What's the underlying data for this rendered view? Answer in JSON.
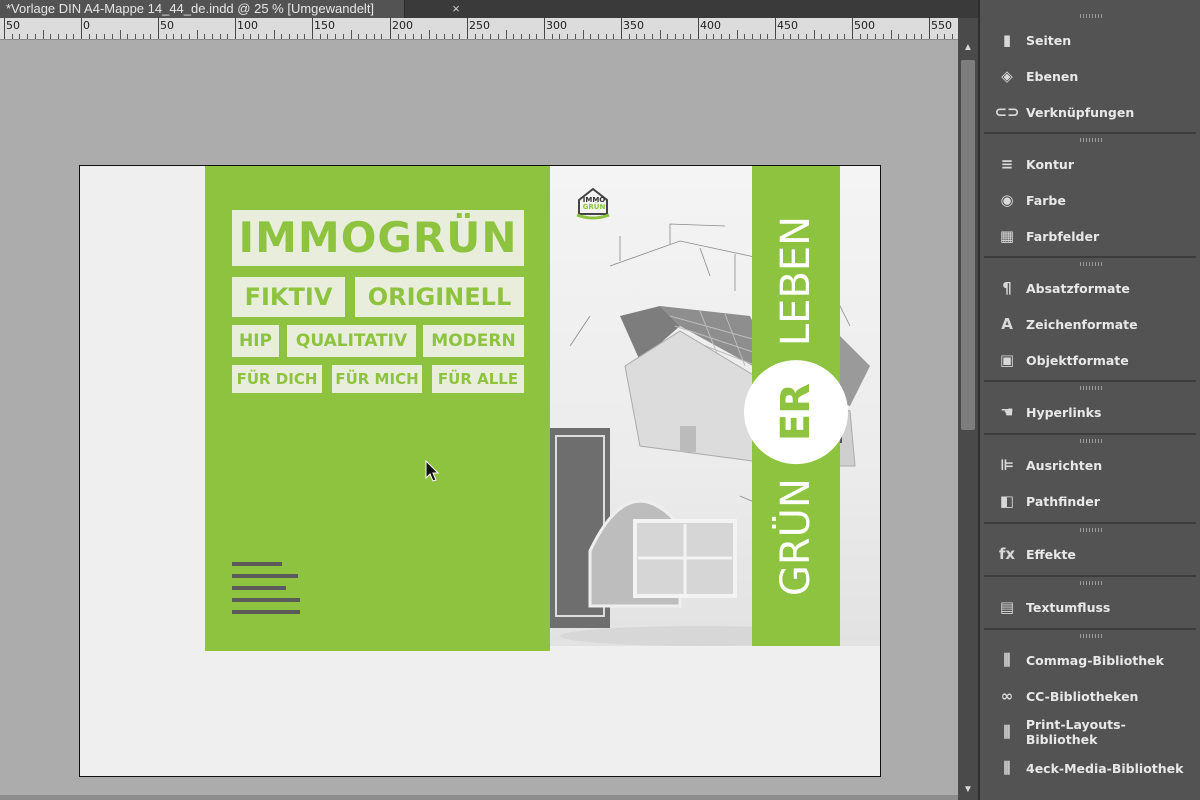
{
  "document": {
    "tab_title": "*Vorlage DIN A4-Mappe 14_44_de.indd @ 25 % [Umgewandelt]",
    "close_glyph": "×"
  },
  "ruler": {
    "labels": [
      "50",
      "0",
      "50",
      "100",
      "150",
      "200",
      "250",
      "300",
      "350",
      "400",
      "450",
      "500",
      "550"
    ]
  },
  "artwork": {
    "brand_headline": "IMMOGRÜN",
    "tags_row1": [
      "FIKTIV",
      "ORIGINELL"
    ],
    "tags_row2": [
      "HIP",
      "QUALITATIV",
      "MODERN"
    ],
    "tags_row3": [
      "FÜR DICH",
      "FÜR MICH",
      "FÜR ALLE"
    ],
    "logo_text_line1": "IMMO",
    "logo_text_line2": "GRÜN",
    "vertical_left": "GRÜN",
    "vertical_circle": "ER",
    "vertical_right": "LEBEN",
    "accent_color": "#8dc33f"
  },
  "panel": {
    "groups": [
      [
        {
          "label": "Seiten",
          "icon": "pages-icon"
        },
        {
          "label": "Ebenen",
          "icon": "layers-icon"
        },
        {
          "label": "Verknüpfungen",
          "icon": "links-icon"
        }
      ],
      [
        {
          "label": "Kontur",
          "icon": "stroke-icon"
        },
        {
          "label": "Farbe",
          "icon": "color-palette-icon"
        },
        {
          "label": "Farbfelder",
          "icon": "swatches-icon"
        }
      ],
      [
        {
          "label": "Absatzformate",
          "icon": "paragraph-styles-icon"
        },
        {
          "label": "Zeichenformate",
          "icon": "character-styles-icon"
        },
        {
          "label": "Objektformate",
          "icon": "object-styles-icon"
        }
      ],
      [
        {
          "label": "Hyperlinks",
          "icon": "hyperlinks-icon"
        }
      ],
      [
        {
          "label": "Ausrichten",
          "icon": "align-icon"
        },
        {
          "label": "Pathfinder",
          "icon": "pathfinder-icon"
        }
      ],
      [
        {
          "label": "Effekte",
          "icon": "effects-icon"
        }
      ],
      [
        {
          "label": "Textumfluss",
          "icon": "text-wrap-icon"
        }
      ],
      [
        {
          "label": "Commag-Bibliothek",
          "icon": "library-icon"
        },
        {
          "label": "CC-Bibliotheken",
          "icon": "cc-libraries-icon"
        },
        {
          "label": "Print-Layouts-Bibliothek",
          "icon": "library-icon"
        },
        {
          "label": "4eck-Media-Bibliothek",
          "icon": "library-icon"
        }
      ]
    ]
  }
}
